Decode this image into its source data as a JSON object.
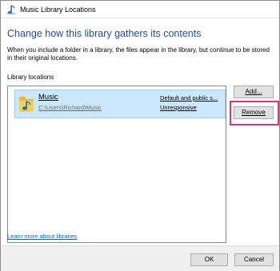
{
  "window": {
    "title": "Music Library Locations"
  },
  "heading": "Change how this library gathers its contents",
  "description": "When you include a folder in a library, the files appear in the library, but continue to be stored in their original locations.",
  "library_locations": {
    "label": "Library locations",
    "items": [
      {
        "name": "Music",
        "path": "C:\\Users\\Richard\\Music",
        "status_primary": "Default and public s...",
        "status_secondary": "Unresponsive",
        "icon": "music-folder-icon",
        "selected": true
      }
    ]
  },
  "buttons": {
    "add": "Add...",
    "remove": "Remove",
    "ok": "OK",
    "cancel": "Cancel"
  },
  "learn_more": "Learn more about libraries",
  "colors": {
    "heading": "#1f4e9e",
    "selection": "#cce8ff",
    "highlight_border": "#e8306b",
    "link": "#0066cc"
  }
}
